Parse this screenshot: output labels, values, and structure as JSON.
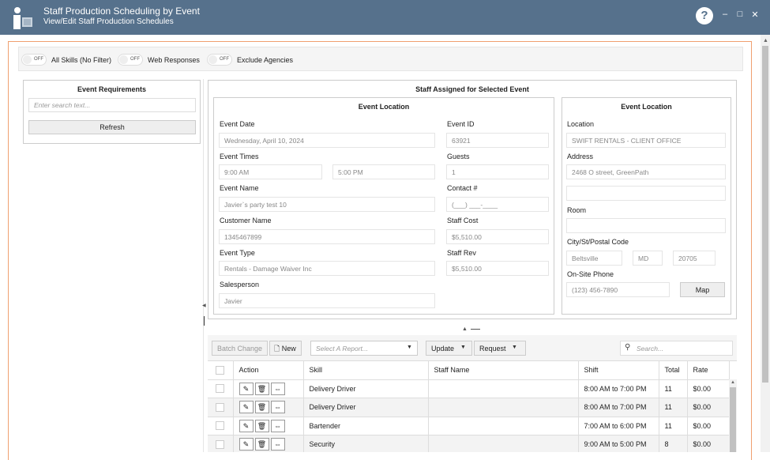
{
  "window": {
    "title": "Staff Production Scheduling by Event",
    "subtitle": "View/Edit Staff Production Schedules",
    "help": "?",
    "minimize": "–",
    "maximize": "□",
    "close": "✕"
  },
  "filters": {
    "off_text": "OFF",
    "all_skills": "All Skills (No Filter)",
    "web_responses": "Web Responses",
    "exclude_agencies": "Exclude Agencies"
  },
  "requirements": {
    "title": "Event Requirements",
    "search_placeholder": "Enter search text...",
    "refresh": "Refresh"
  },
  "staff_assigned": {
    "title": "Staff Assigned for Selected Event",
    "loc_title_a": "Event Location",
    "loc_title_b": "Event Location",
    "event_date_label": "Event Date",
    "event_date": "Wednesday, April 10, 2024",
    "event_times_label": "Event Times",
    "start_time": "9:00 AM",
    "end_time": "5:00 PM",
    "event_name_label": "Event Name",
    "event_name": "Javier`s party test 10",
    "customer_name_label": "Customer Name",
    "customer_name": "1345467899",
    "event_type_label": "Event Type",
    "event_type": "Rentals - Damage Waiver Inc",
    "salesperson_label": "Salesperson",
    "salesperson": "Javier",
    "event_id_label": "Event ID",
    "event_id": "63921",
    "guests_label": "Guests",
    "guests": "1",
    "contact_label": "Contact #",
    "contact": "(___) ___-____",
    "staff_cost_label": "Staff Cost",
    "staff_cost": "$5,510.00",
    "staff_rev_label": "Staff Rev",
    "staff_rev": "$5,510.00",
    "location_label": "Location",
    "location": "SWIFT RENTALS - CLIENT OFFICE",
    "address_label": "Address",
    "address1": "2468 O street, GreenPath",
    "address2": "",
    "room_label": "Room",
    "room": "",
    "city_label": "City/St/Postal Code",
    "city": "Beltsville",
    "state": "MD",
    "postal": "20705",
    "phone_label": "On-Site Phone",
    "phone": "(123) 456-7890",
    "map": "Map"
  },
  "toolbar": {
    "batch_change": "Batch Change",
    "new": "New",
    "report_placeholder": "Select A Report...",
    "update": "Update",
    "request": "Request",
    "search_placeholder": "Search..."
  },
  "grid": {
    "headers": {
      "action": "Action",
      "skill": "Skill",
      "staff_name": "Staff Name",
      "shift": "Shift",
      "total": "Total",
      "rate": "Rate"
    },
    "rows": [
      {
        "skill": "Delivery Driver",
        "staff_name": "",
        "shift": "8:00 AM to 7:00 PM",
        "total": "11",
        "rate": "$0.00"
      },
      {
        "skill": "Delivery Driver",
        "staff_name": "",
        "shift": "8:00 AM to 7:00 PM",
        "total": "11",
        "rate": "$0.00"
      },
      {
        "skill": "Bartender",
        "staff_name": "",
        "shift": "7:00 AM to 6:00 PM",
        "total": "11",
        "rate": "$0.00"
      },
      {
        "skill": "Security",
        "staff_name": "",
        "shift": "9:00 AM to 5:00 PM",
        "total": "8",
        "rate": "$0.00"
      }
    ]
  },
  "icons": {
    "edit": "edit-icon",
    "delete": "trash-icon",
    "assign": "swap-icon",
    "search": "search-icon",
    "new": "new-document-icon"
  }
}
